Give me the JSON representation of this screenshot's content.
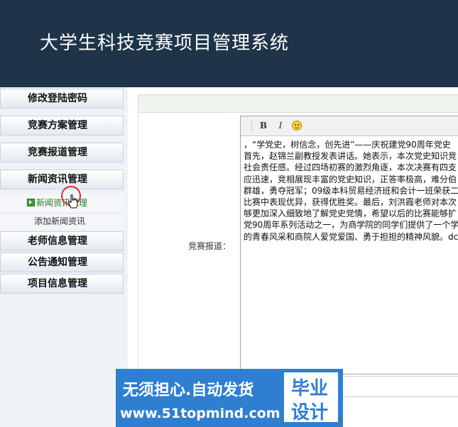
{
  "header": {
    "title": "大学生科技竞赛项目管理系统"
  },
  "sidebar": {
    "items": [
      {
        "label": "修改登陆密码"
      },
      {
        "label": "竞赛方案管理"
      },
      {
        "label": "竞赛报道管理"
      },
      {
        "label": "新闻资讯管理"
      },
      {
        "label": "老师信息管理"
      },
      {
        "label": "公告通知管理"
      },
      {
        "label": "项目信息管理"
      }
    ],
    "submenu": [
      {
        "label": "新闻资讯管理"
      },
      {
        "label": "添加新闻资讯"
      }
    ]
  },
  "form": {
    "report_label": "竞赛报道："
  },
  "editor": {
    "toolbar": {
      "bold": "B",
      "italic": "I"
    },
    "lines": [
      "，“学党史，树信念，创先进”——庆祝建党90周年党史",
      "首先，赵锦兰副教授发表讲话。她表示，本次党史知识竞",
      "社会责任感。经过四场初赛的激烈角逐，本次决赛有四支",
      "应迅速，竞相展现丰富的党史知识，正答率极高，难分伯",
      "群雄，勇夺冠军；09级本科贸易经济班和会计一班荣获二",
      "比赛中表现优异，获得优胜奖。最后，刘洪霞老师对本次",
      "够更加深入细致地了解党史党情，希望以后的比赛能够扩",
      "党90周年系列活动之一，为商学院的同学们提供了一个学",
      "的青春风采和商院人爱党爱国、勇于担担的精神风貌。dc"
    ]
  },
  "watermark": {
    "line1": "无须担心.自动发货",
    "line2": "www.51topmind.com",
    "box1": "毕业",
    "box2": "设计"
  }
}
